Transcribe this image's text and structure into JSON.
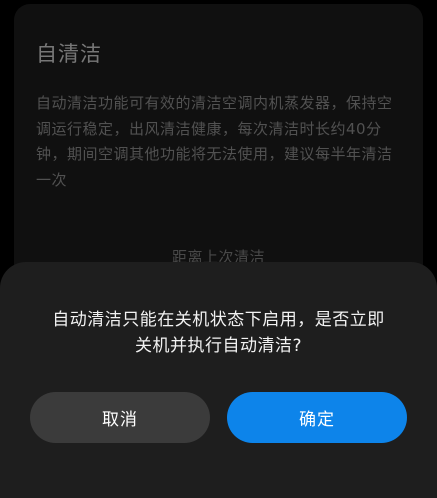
{
  "background_card": {
    "title": "自清洁",
    "description": "自动清洁功能可有效的清洁空调内机蒸发器，保持空调运行稳定，出风清洁健康，每次清洁时长约40分钟，期间空调其他功能将无法使用，建议每半年清洁一次",
    "last_clean_label": "距离上次清洁"
  },
  "dialog": {
    "message_line1": "自动清洁只能在关机状态下启用，是否立即",
    "message_line2": "关机并执行自动清洁?",
    "cancel_label": "取消",
    "confirm_label": "确定"
  },
  "colors": {
    "confirm_button": "#0d84ea",
    "cancel_button": "#3b3b3b",
    "sheet_background": "#1e1e1e"
  }
}
